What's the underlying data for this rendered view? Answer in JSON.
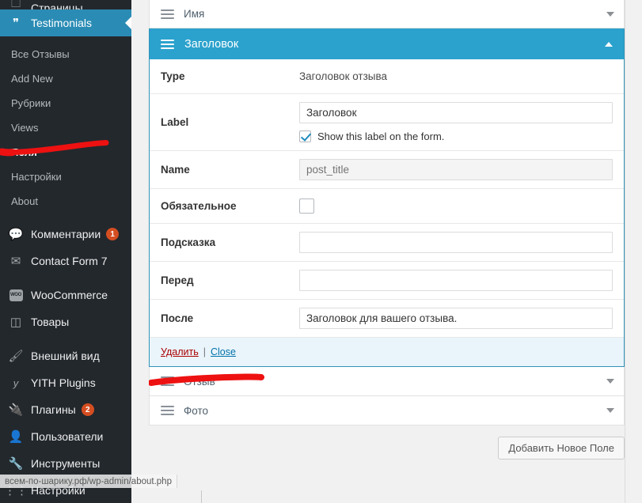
{
  "sidebar": {
    "cut_item": {
      "label": "Страницы",
      "icon": "pages-icon"
    },
    "current": {
      "label": "Testimonials",
      "icon": "quote-icon"
    },
    "submenu": [
      {
        "label": "Все Отзывы",
        "current": false
      },
      {
        "label": "Add New",
        "current": false
      },
      {
        "label": "Рубрики",
        "current": false
      },
      {
        "label": "Views",
        "current": false
      },
      {
        "label": "Поля",
        "current": true
      },
      {
        "label": "Настройки",
        "current": false
      },
      {
        "label": "About",
        "current": false
      }
    ],
    "items": [
      {
        "label": "Комментарии",
        "icon": "comment-icon",
        "badge": "1"
      },
      {
        "label": "Contact Form 7",
        "icon": "envelope-icon",
        "badge": ""
      },
      {
        "label": "WooCommerce",
        "icon": "woo-icon",
        "badge": ""
      },
      {
        "label": "Товары",
        "icon": "box-icon",
        "badge": ""
      },
      {
        "label": "Внешний вид",
        "icon": "brush-icon",
        "badge": ""
      },
      {
        "label": "YITH Plugins",
        "icon": "yith-icon",
        "badge": ""
      },
      {
        "label": "Плагины",
        "icon": "plug-icon",
        "badge": "2"
      },
      {
        "label": "Пользователи",
        "icon": "user-icon",
        "badge": ""
      },
      {
        "label": "Инструменты",
        "icon": "wrench-icon",
        "badge": ""
      },
      {
        "label": "Настройки",
        "icon": "sliders-icon",
        "badge": ""
      }
    ]
  },
  "main": {
    "row_above": {
      "title": "Имя",
      "icon": "drag-handle-icon",
      "caret": "chevron-down-icon"
    },
    "open_panel": {
      "title": "Заголовок",
      "icon": "drag-handle-icon",
      "caret": "chevron-up-icon",
      "header_color": "#2ba2cd",
      "rows": [
        {
          "label": "Type",
          "kind": "text",
          "value": "Заголовок отзыва"
        },
        {
          "label": "Label",
          "kind": "input",
          "value": "Заголовок",
          "placeholder": "",
          "checkbox": {
            "checked": true,
            "text": "Show this label on the form."
          }
        },
        {
          "label": "Name",
          "kind": "input-disabled",
          "value": "",
          "placeholder": "post_title"
        },
        {
          "label": "Обязательное",
          "kind": "checkbox",
          "checked": false
        },
        {
          "label": "Подсказка",
          "kind": "input",
          "value": "",
          "placeholder": ""
        },
        {
          "label": "Перед",
          "kind": "input",
          "value": "",
          "placeholder": ""
        },
        {
          "label": "После",
          "kind": "input",
          "value": "Заголовок для вашего отзыва.",
          "placeholder": ""
        }
      ],
      "footer": {
        "delete_label": "Удалить",
        "separator": "|",
        "close_label": "Close"
      }
    },
    "rows_below": [
      {
        "title": "Отзыв",
        "icon": "drag-handle-icon",
        "caret": "chevron-down-icon"
      },
      {
        "title": "Фото",
        "icon": "drag-handle-icon",
        "caret": "chevron-down-icon"
      }
    ],
    "add_button": "Добавить Новое Поле"
  },
  "statusbar": {
    "url": "всем-по-шарику.рф/wp-admin/about.php"
  },
  "annotations": {
    "color": "#ee1111",
    "count": 2
  }
}
